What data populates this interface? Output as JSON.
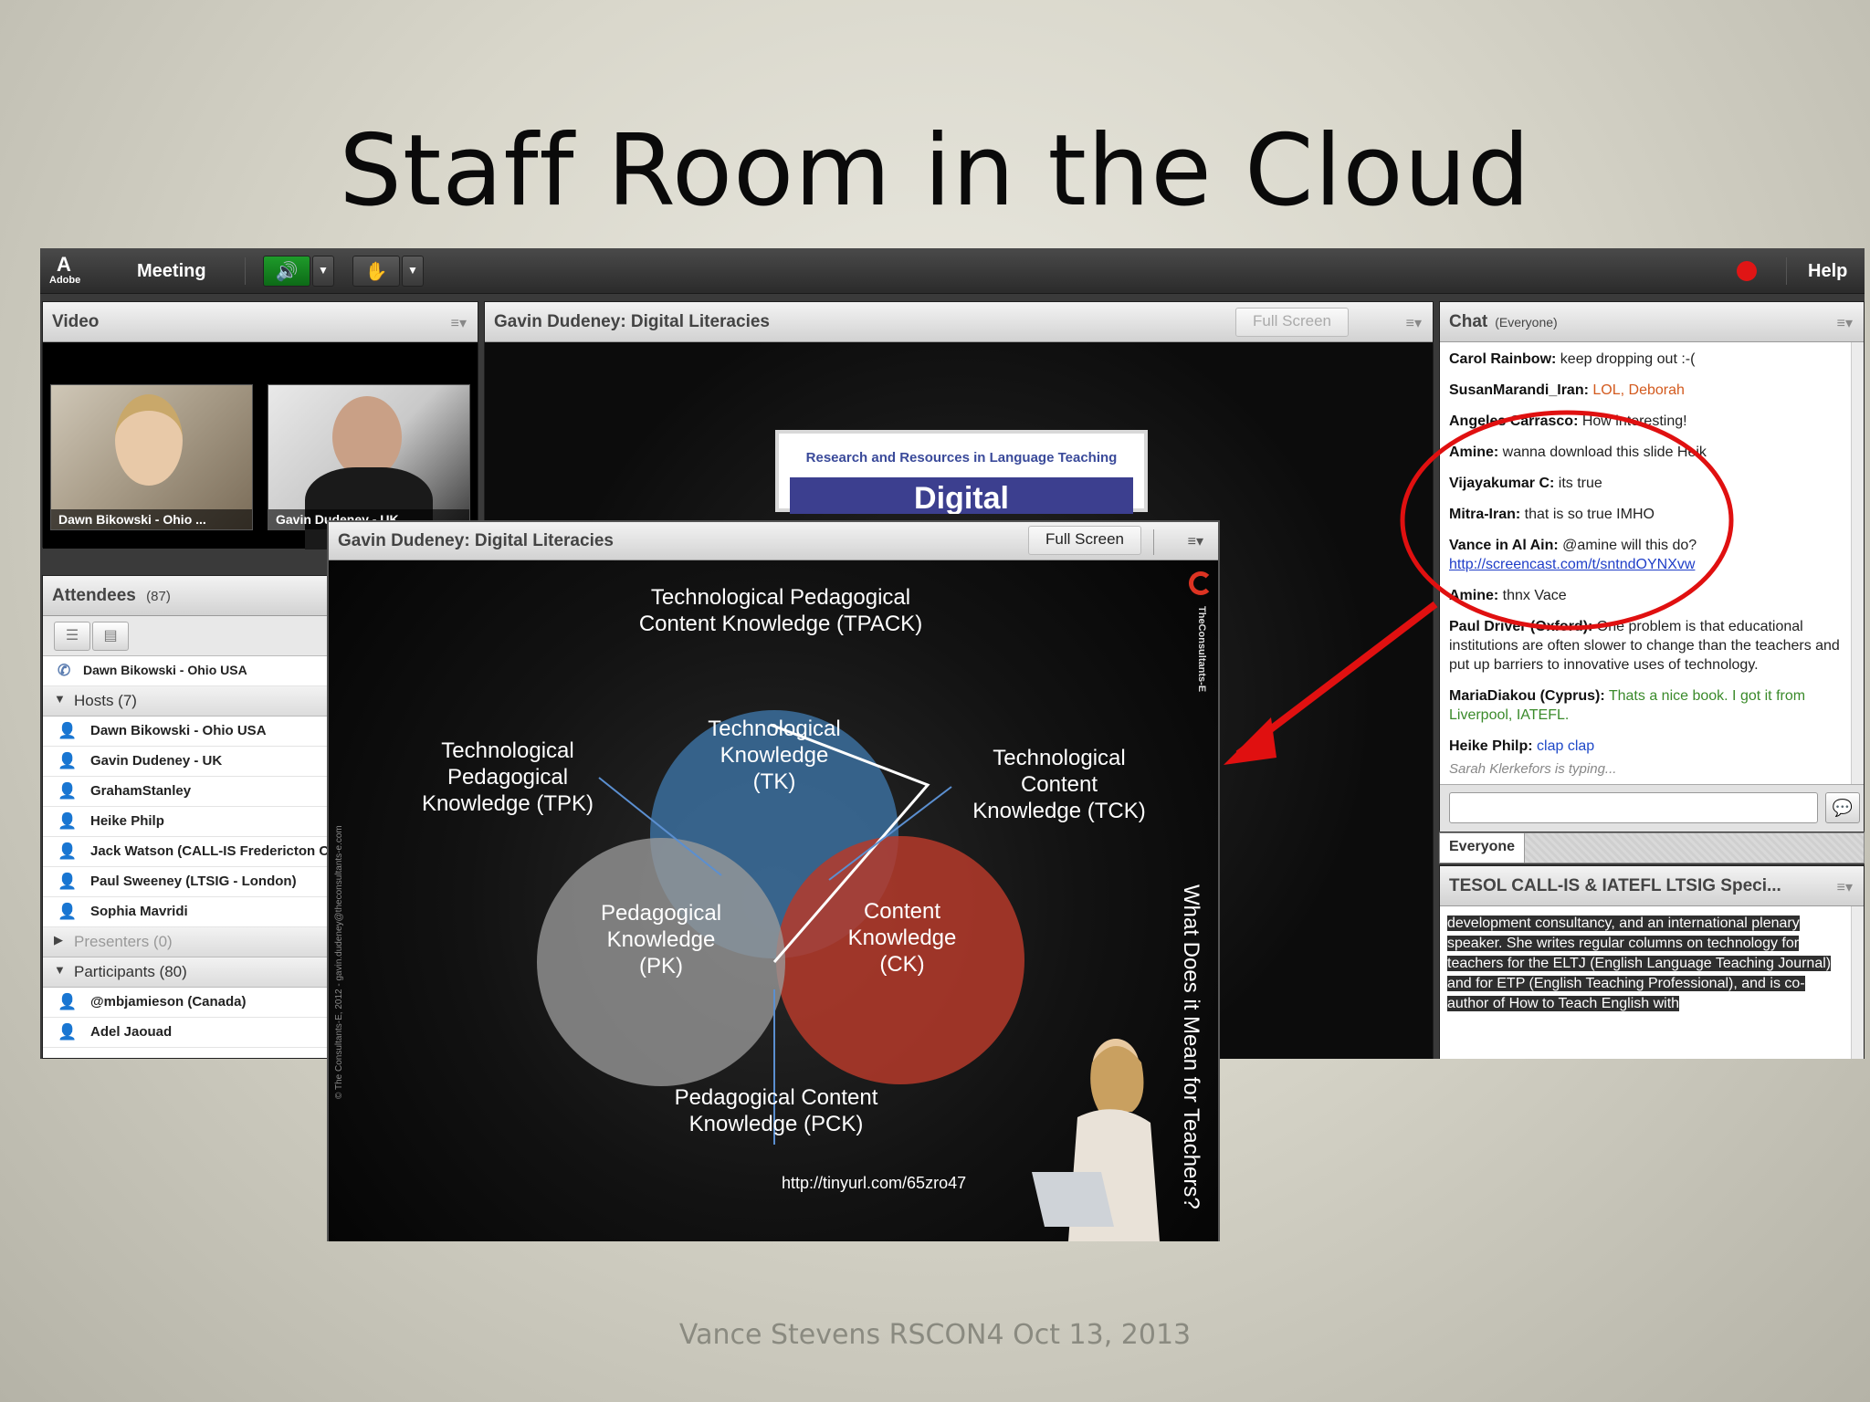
{
  "slide": {
    "title": "Staff Room in the Cloud",
    "footer": "Vance Stevens RSCON4 Oct 13, 2013"
  },
  "app": {
    "logo_text": "Adobe",
    "menu_meeting": "Meeting",
    "help": "Help",
    "colors": {
      "speaker_green": "#1e9b2a",
      "record_red": "#e01515"
    }
  },
  "video": {
    "title": "Video",
    "feeds": [
      {
        "label": "Dawn Bikowski - Ohio ..."
      },
      {
        "label": "Gavin Dudeney - UK"
      }
    ]
  },
  "attendees": {
    "title": "Attendees",
    "count": "(87)",
    "speaking": "Dawn Bikowski - Ohio USA",
    "hosts_label": "Hosts (7)",
    "hosts": [
      "Dawn Bikowski - Ohio USA",
      "Gavin Dudeney - UK",
      "GrahamStanley",
      "Heike Philp",
      "Jack  Watson (CALL-IS Fredericton C",
      "Paul Sweeney (LTSIG - London)",
      "Sophia Mavridi"
    ],
    "presenters_label": "Presenters (0)",
    "participants_label": "Participants (80)",
    "participants": [
      "@mbjamieson (Canada)",
      "Adel Jaouad"
    ]
  },
  "share_back": {
    "title": "Gavin Dudeney: Digital Literacies",
    "fullscreen": "Full Screen",
    "card_title": "Research and Resources in Language Teaching",
    "card_banner": "Digital"
  },
  "chat": {
    "title": "Chat",
    "scope": "(Everyone)",
    "messages": [
      {
        "name": "Carol Rainbow:",
        "text": " keep dropping out :-("
      },
      {
        "name": "SusanMarandi_Iran:",
        "text": " LOL, Deborah"
      },
      {
        "name": "Angeles Carrasco:",
        "text": " How interesting!"
      },
      {
        "name": "Amine:",
        "text": " wanna download this slide Heik"
      },
      {
        "name": "Vijayakumar C:",
        "text": " its true"
      },
      {
        "name": "Mitra-Iran:",
        "text": " that is so true IMHO"
      },
      {
        "name": "Vance in Al Ain:",
        "text": " @amine will this do?",
        "link": "http://screencast.com/t/sntndOYNXvw"
      },
      {
        "name": "Amine:",
        "text": " thnx Vace"
      },
      {
        "name": "Paul Driver (Oxford):",
        "text": " One problem is that educational institutions are often slower to change than the teachers and put up barriers to innovative uses of technology."
      },
      {
        "name": "MariaDiakou (Cyprus):",
        "text": " Thats a nice book. I got it from Liverpool, IATEFL."
      },
      {
        "name": "Heike Philp:",
        "text": " clap clap"
      }
    ],
    "typing": "Sarah Klerkefors is typing...",
    "tab_everyone": "Everyone"
  },
  "notes": {
    "title": "TESOL CALL-IS & IATEFL LTSIG Speci...",
    "body": "development consultancy, and an international plenary speaker. She writes regular columns on technology for teachers for the ELTJ (English Language Teaching Journal) and for ETP (English Teaching Professional), and is co-author of How to Teach English with"
  },
  "share_front": {
    "title": "Gavin Dudeney: Digital Literacies",
    "fullscreen": "Full Screen",
    "tpack": "Technological Pedagogical Content Knowledge (TPACK)",
    "tpack_l1": "Technological Pedagogical",
    "tpack_l2": "Content Knowledge (TPACK)",
    "tpk_l1": "Technological",
    "tpk_l2": "Pedagogical",
    "tpk_l3": "Knowledge (TPK)",
    "tk_l1": "Technological",
    "tk_l2": "Knowledge",
    "tk_l3": "(TK)",
    "tck_l1": "Technological",
    "tck_l2": "Content",
    "tck_l3": "Knowledge (TCK)",
    "pk_l1": "Pedagogical",
    "pk_l2": "Knowledge",
    "pk_l3": "(PK)",
    "ck_l1": "Content",
    "ck_l2": "Knowledge",
    "ck_l3": "(CK)",
    "pck_l1": "Pedagogical Content",
    "pck_l2": "Knowledge (PCK)",
    "url": "http://tinyurl.com/65zro47",
    "question": "What Does it Mean for Teachers?",
    "brand": "TheConsultants-E",
    "copyright": "© The Consultants-E, 2012 - gavin.dudeney@theconsultants-e.com",
    "colors": {
      "tk": "#3b6e9e",
      "ck": "#b53a2a",
      "pk": "#8a8a8a"
    }
  }
}
